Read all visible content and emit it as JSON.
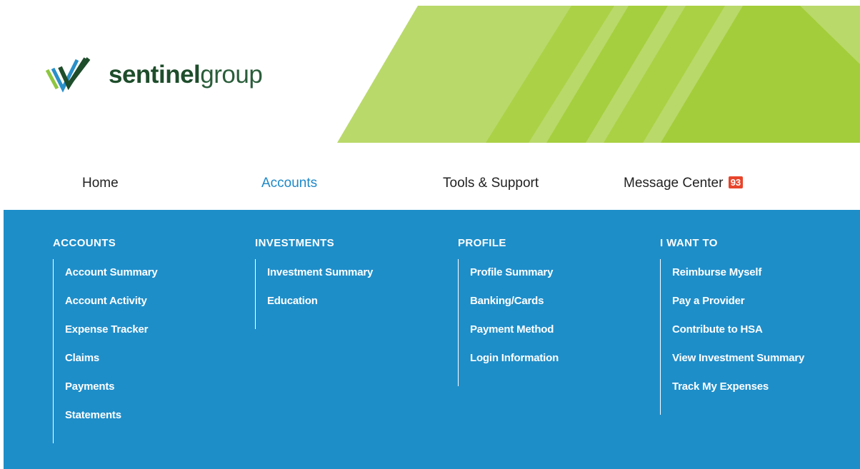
{
  "brand": {
    "name_bold": "sentinel",
    "name_light": "group",
    "colors": {
      "green_dark": "#1e4d2b",
      "banner_green": "#a8d04a",
      "menu_blue": "#1e8ec9",
      "badge_red": "#e8452c",
      "active_blue": "#1e88c8"
    }
  },
  "topnav": {
    "home": "Home",
    "accounts": "Accounts",
    "tools": "Tools & Support",
    "messages": "Message Center",
    "messages_badge": "93"
  },
  "menu": {
    "accounts": {
      "title": "ACCOUNTS",
      "links": [
        "Account Summary",
        "Account Activity",
        "Expense Tracker",
        "Claims",
        "Payments",
        "Statements"
      ]
    },
    "investments": {
      "title": "INVESTMENTS",
      "links": [
        "Investment Summary",
        "Education"
      ]
    },
    "profile": {
      "title": "PROFILE",
      "links": [
        "Profile Summary",
        "Banking/Cards",
        "Payment Method",
        "Login Information"
      ]
    },
    "iwant": {
      "title": "I WANT TO",
      "links": [
        "Reimburse Myself",
        "Pay a Provider",
        "Contribute to HSA",
        "View Investment Summary",
        "Track My Expenses"
      ]
    }
  }
}
